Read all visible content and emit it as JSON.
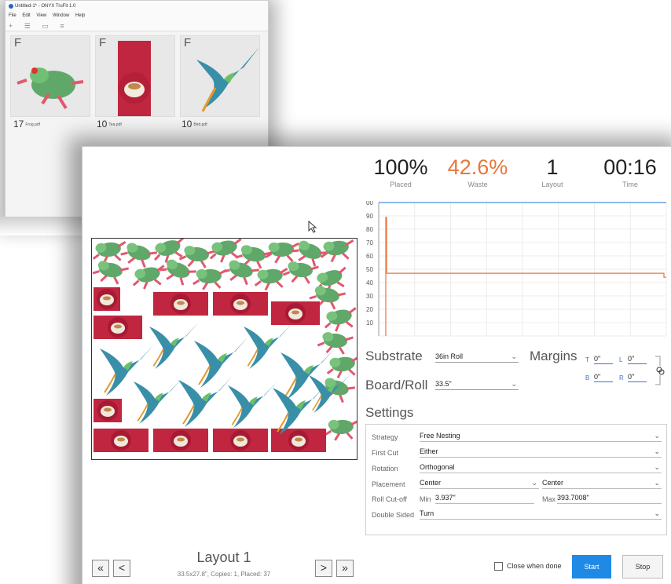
{
  "back_window": {
    "title": "Untitled-1* - ONYX TruFit 1.0",
    "menu": [
      "File",
      "Edit",
      "View",
      "Window",
      "Help"
    ],
    "tool_icons": [
      "add-icon",
      "list-view-icon",
      "grid-view-icon",
      "sort-icon"
    ],
    "cards": [
      {
        "flag": "F",
        "count": "17",
        "file": "Frog.pdf",
        "thumb": "frog"
      },
      {
        "flag": "F",
        "count": "10",
        "file": "Tea.pdf",
        "thumb": "tea"
      },
      {
        "flag": "F",
        "count": "10",
        "file": "Bird.pdf",
        "thumb": "bird"
      }
    ]
  },
  "stats": [
    {
      "value": "100%",
      "label": "Placed"
    },
    {
      "value": "42.6%",
      "label": "Waste"
    },
    {
      "value": "1",
      "label": "Layout"
    },
    {
      "value": "00:16",
      "label": "Time"
    }
  ],
  "chart_data": {
    "type": "line",
    "y_ticks": [
      "00",
      "90",
      "80",
      "70",
      "60",
      "50",
      "40",
      "30",
      "20",
      "10"
    ],
    "ylim": [
      0,
      100
    ],
    "grid": true,
    "series": [
      {
        "color": "#4a90d9",
        "values": [
          100,
          100
        ]
      },
      {
        "color": "#e8763b",
        "values": [
          0,
          89,
          47,
          47,
          44
        ]
      }
    ]
  },
  "substrate": {
    "label": "Substrate",
    "value": "36in Roll"
  },
  "board_roll": {
    "label": "Board/Roll",
    "value": "33.5\""
  },
  "margins": {
    "label": "Margins",
    "t_label": "T",
    "t": "0\"",
    "l_label": "L",
    "l": "0\"",
    "b_label": "B",
    "b": "0\"",
    "r_label": "R",
    "r": "0\""
  },
  "settings": {
    "title": "Settings",
    "strategy": {
      "label": "Strategy",
      "value": "Free Nesting"
    },
    "first_cut": {
      "label": "First Cut",
      "value": "Either"
    },
    "rotation": {
      "label": "Rotation",
      "value": "Orthogonal"
    },
    "placement": {
      "label": "Placement",
      "value1": "Center",
      "value2": "Center"
    },
    "roll_cutoff": {
      "label": "Roll Cut-off",
      "min_label": "Min",
      "min": "3.937\"",
      "max_label": "Max",
      "max": "393.7008\""
    },
    "double_sided": {
      "label": "Double Sided",
      "value": "Turn"
    }
  },
  "layout_nav": {
    "title": "Layout 1",
    "subtitle": "33.5x27.8\", Copies: 1, Placed: 37",
    "first": "«",
    "prev": "<",
    "next": ">",
    "last": "»"
  },
  "footer": {
    "close_when_done": "Close when done",
    "start": "Start",
    "stop": "Stop"
  },
  "colors": {
    "accent": "#1e8ae6",
    "waste": "#e8763b",
    "placed_line": "#4a90d9",
    "frog": "#5fa86a",
    "tea": "#c0263f",
    "bird": "#3a8fa8"
  }
}
